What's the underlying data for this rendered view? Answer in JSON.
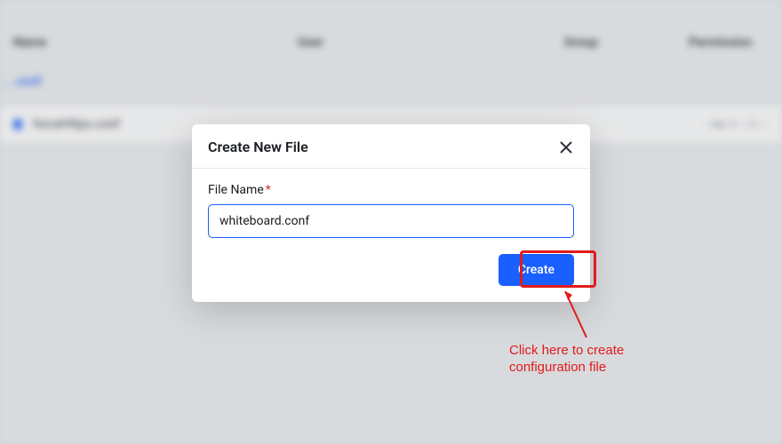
{
  "background": {
    "headers": {
      "name": "Name",
      "user": "User",
      "group": "Group",
      "permission": "Permission"
    },
    "back_link": ". . .conf",
    "file_row": {
      "name": "forceHttps.conf",
      "permission": "-rw-r--r--"
    }
  },
  "modal": {
    "title": "Create New File",
    "field_label": "File Name",
    "required_mark": "*",
    "file_name_value": "whiteboard.conf",
    "create_label": "Create"
  },
  "annotation": {
    "text_line1": "Click here to create",
    "text_line2": "configuration file"
  }
}
